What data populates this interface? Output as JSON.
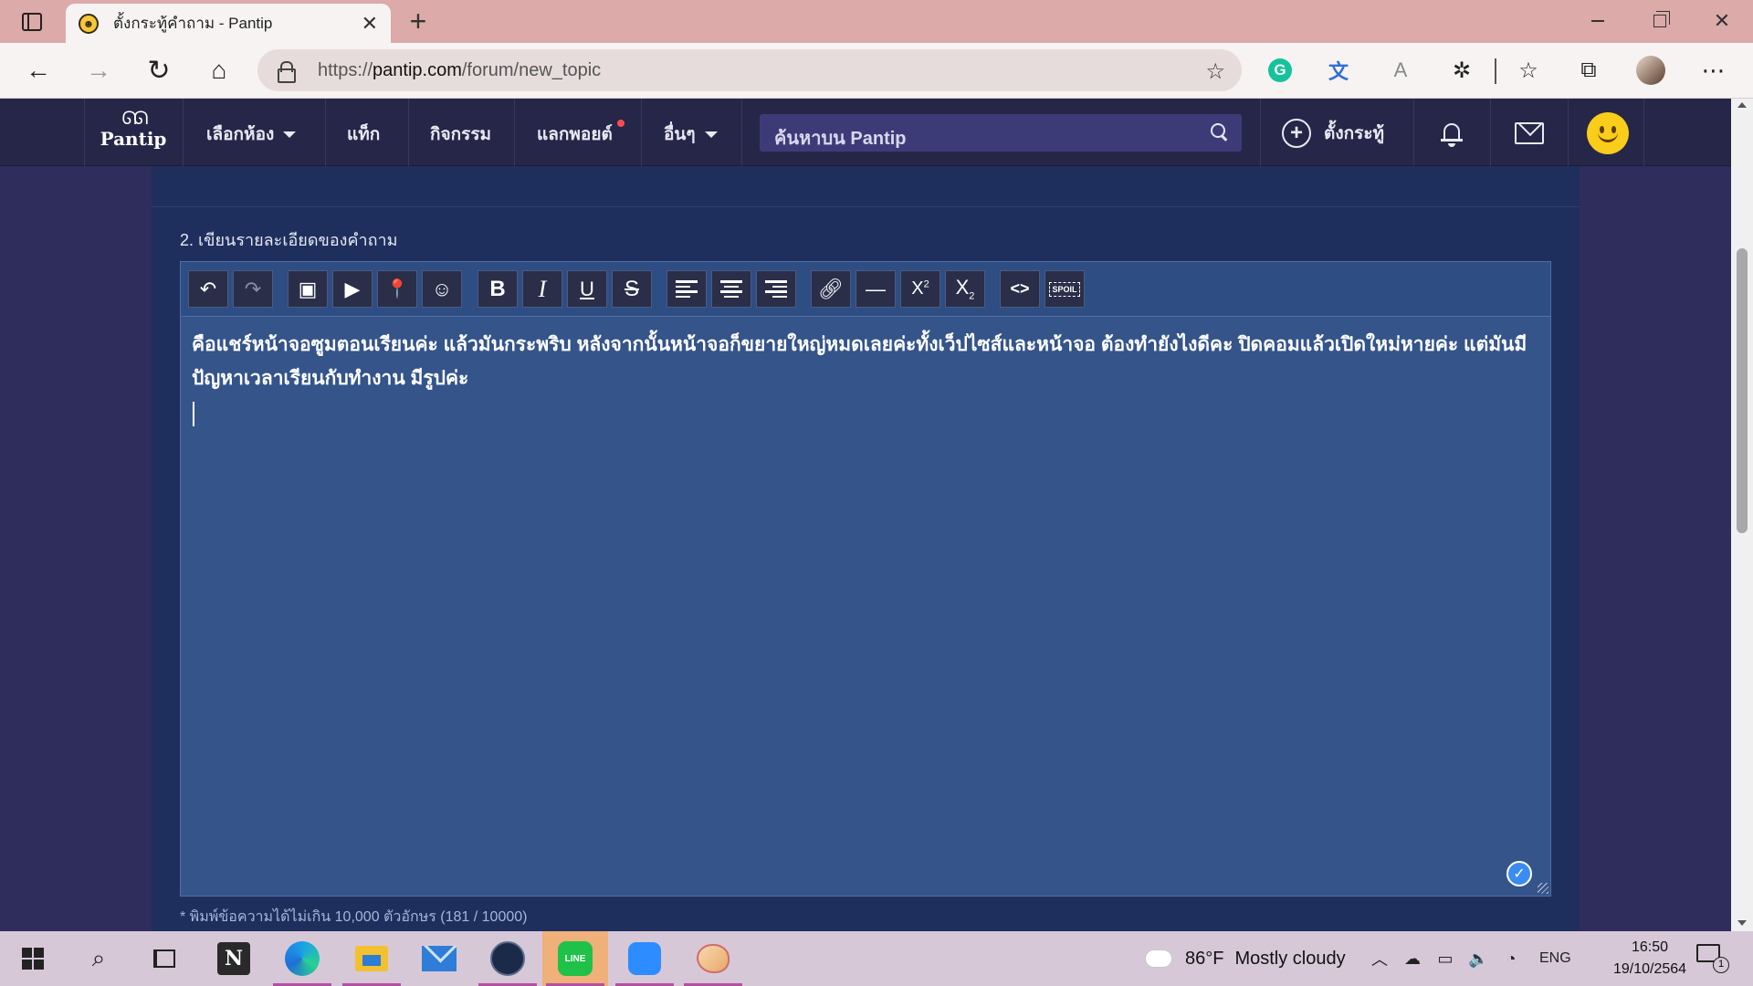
{
  "browser": {
    "tab": {
      "title": "ตั้งกระทู้คำถาม - Pantip",
      "close_glyph": "✕"
    },
    "new_tab_glyph": "+",
    "window": {
      "minimize": "",
      "maximize": "",
      "close_glyph": "✕"
    },
    "nav": {
      "back_glyph": "←",
      "forward_glyph": "→",
      "reload_glyph": "↻",
      "home_glyph": "⌂"
    },
    "url": {
      "scheme": "https://",
      "host": "pantip.com",
      "path": "/forum/new_topic"
    },
    "extensions": {
      "grammarly": "G",
      "translate": "文",
      "reader": "A",
      "more_glyph": "⋯"
    }
  },
  "site": {
    "logo": {
      "mark": "ᘏᘏ",
      "text": "Pantip"
    },
    "nav": {
      "rooms": "เลือกห้อง",
      "tags": "แท็ก",
      "activities": "กิจกรรม",
      "redeem": "แลกพอยต์",
      "others": "อื่นๆ"
    },
    "search": {
      "placeholder": "ค้นหาบน Pantip"
    },
    "new_topic": "ตั้งกระทู้",
    "accent_color": "#f9cd1a"
  },
  "form": {
    "section_label": "2. เขียนรายละเอียดของคำถาม",
    "toolbar": {
      "undo": "↶",
      "redo": "↷",
      "image": "▣",
      "video": "▶",
      "location": "⬤",
      "emoji": "☺",
      "bold": "B",
      "italic": "I",
      "underline": "U",
      "strike": "S",
      "link": "⊖",
      "hr": "—",
      "sup": "X",
      "sup_small": "2",
      "sub": "X",
      "sub_small": "2",
      "code": "<>",
      "spoil": "SPOIL"
    },
    "body_text": "คือแชร์หน้าจอซูมตอนเรียนค่ะ แล้วมันกระพริบ หลังจากนั้นหน้าจอก็ขยายใหญ่หมดเลยค่ะทั้งเว็ปไซส์และหน้าจอ ต้องทำยังไงดีคะ ปิดคอมแล้วเปิดใหม่หายค่ะ แต่มันมีปัญหาเวลาเรียนกับทำงาน มีรูปค่ะ",
    "status_check": "✓",
    "char_count": "* พิมพ์ข้อความได้ไม่เกิน 10,000 ตัวอักษร (181 / 10000)"
  },
  "taskbar": {
    "apps": [
      "Start",
      "Search",
      "Task View",
      "Notion",
      "Microsoft Edge",
      "File Explorer",
      "Mail",
      "Steam",
      "LINE",
      "Zoom",
      "Paint"
    ],
    "notion_letter": "N",
    "line_label": "LINE",
    "search_glyph": "⌕",
    "weather": {
      "temp": "86°F",
      "condition": "Mostly cloudy"
    },
    "tray": {
      "chevron": "︿",
      "cloud": "☁",
      "battery": "▭",
      "volume": "🔈",
      "wifi": "◔",
      "lang": "ENG"
    },
    "clock": {
      "time": "16:50",
      "date": "19/10/2564"
    },
    "notifications": "1"
  }
}
